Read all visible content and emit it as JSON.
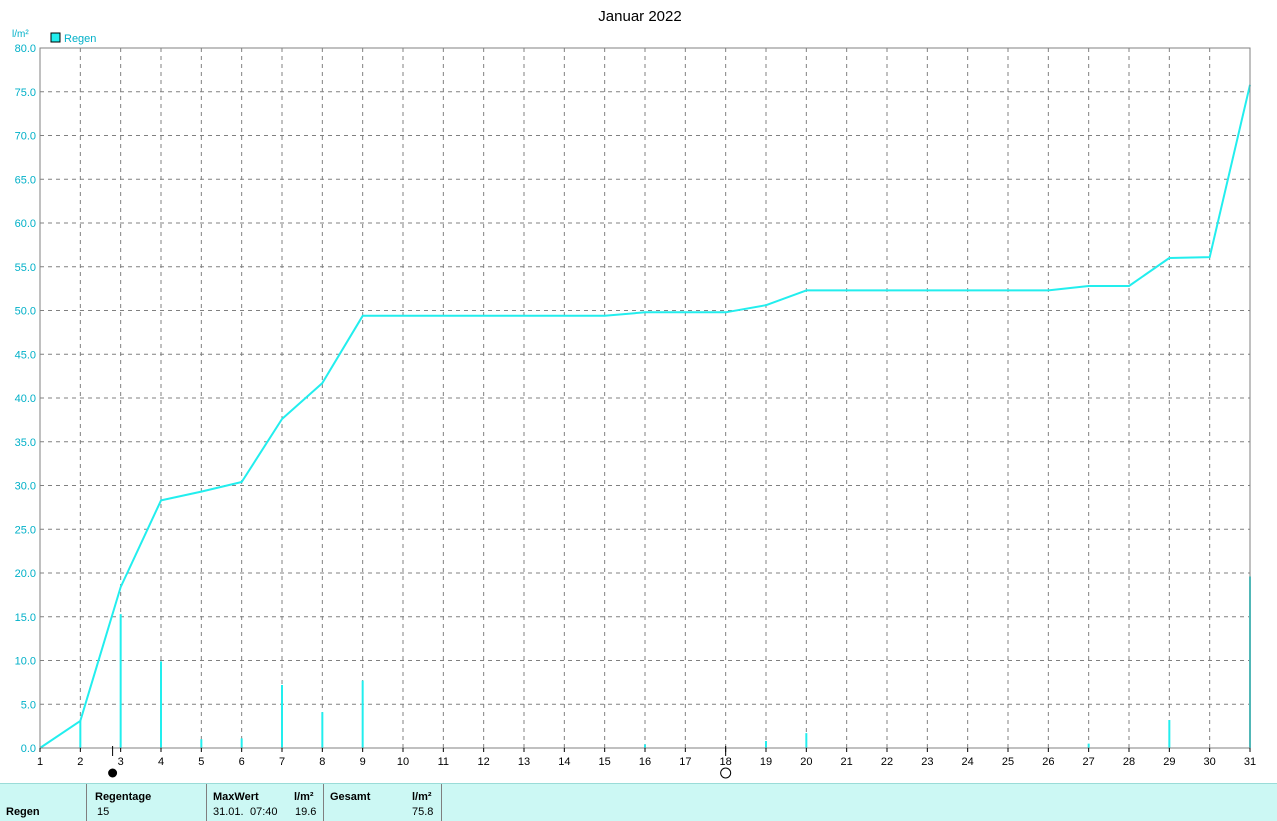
{
  "chart_data": {
    "type": "line",
    "title": "Januar 2022",
    "ylabel": "l/m²",
    "ylim": [
      0,
      80
    ],
    "yticks": [
      "0.0",
      "5.0",
      "10.0",
      "15.0",
      "20.0",
      "25.0",
      "30.0",
      "35.0",
      "40.0",
      "45.0",
      "50.0",
      "55.0",
      "60.0",
      "65.0",
      "70.0",
      "75.0",
      "80.0"
    ],
    "xlim": [
      1,
      31
    ],
    "xticks": [
      "1",
      "2",
      "3",
      "4",
      "5",
      "6",
      "7",
      "8",
      "9",
      "10",
      "11",
      "12",
      "13",
      "14",
      "15",
      "16",
      "17",
      "18",
      "19",
      "20",
      "21",
      "22",
      "23",
      "24",
      "25",
      "26",
      "27",
      "28",
      "29",
      "30",
      "31"
    ],
    "grid": true,
    "legend": "top-left",
    "legend_label": "Regen",
    "color": "#22eeee",
    "series": [
      {
        "name": "Regen",
        "kind": "cumulative_line",
        "x": [
          1,
          2,
          3,
          4,
          5,
          6,
          7,
          8,
          9,
          10,
          11,
          12,
          13,
          14,
          15,
          16,
          17,
          18,
          19,
          20,
          21,
          22,
          23,
          24,
          25,
          26,
          27,
          28,
          29,
          30,
          31
        ],
        "values": [
          0.0,
          3.1,
          18.4,
          28.3,
          29.3,
          30.4,
          37.6,
          41.7,
          49.4,
          49.4,
          49.4,
          49.4,
          49.4,
          49.4,
          49.4,
          49.8,
          49.8,
          49.8,
          50.6,
          52.3,
          52.3,
          52.3,
          52.3,
          52.3,
          52.3,
          52.3,
          52.8,
          52.8,
          56.0,
          56.1,
          75.8
        ]
      },
      {
        "name": "Regen",
        "kind": "daily_bars",
        "x": [
          2,
          3,
          4,
          5,
          6,
          7,
          8,
          9,
          16,
          19,
          20,
          27,
          29,
          31
        ],
        "values": [
          3.1,
          15.3,
          9.9,
          1.0,
          1.1,
          7.2,
          4.1,
          7.7,
          0.4,
          0.8,
          1.7,
          0.5,
          3.2,
          19.6
        ]
      }
    ],
    "moon_phases": [
      {
        "x": 2.8,
        "phase": "new-moon"
      },
      {
        "x": 18.0,
        "phase": "full-moon"
      }
    ]
  },
  "stats": {
    "row_label": "Regen",
    "regentage_header": "Regentage",
    "regentage_value": "15",
    "maxwert_header": "MaxWert",
    "maxwert_unit": "l/m²",
    "maxwert_date": "31.01.",
    "maxwert_time": "07:40",
    "maxwert_value": "19.6",
    "gesamt_header": "Gesamt",
    "gesamt_unit": "l/m²",
    "gesamt_value": "75.8"
  }
}
